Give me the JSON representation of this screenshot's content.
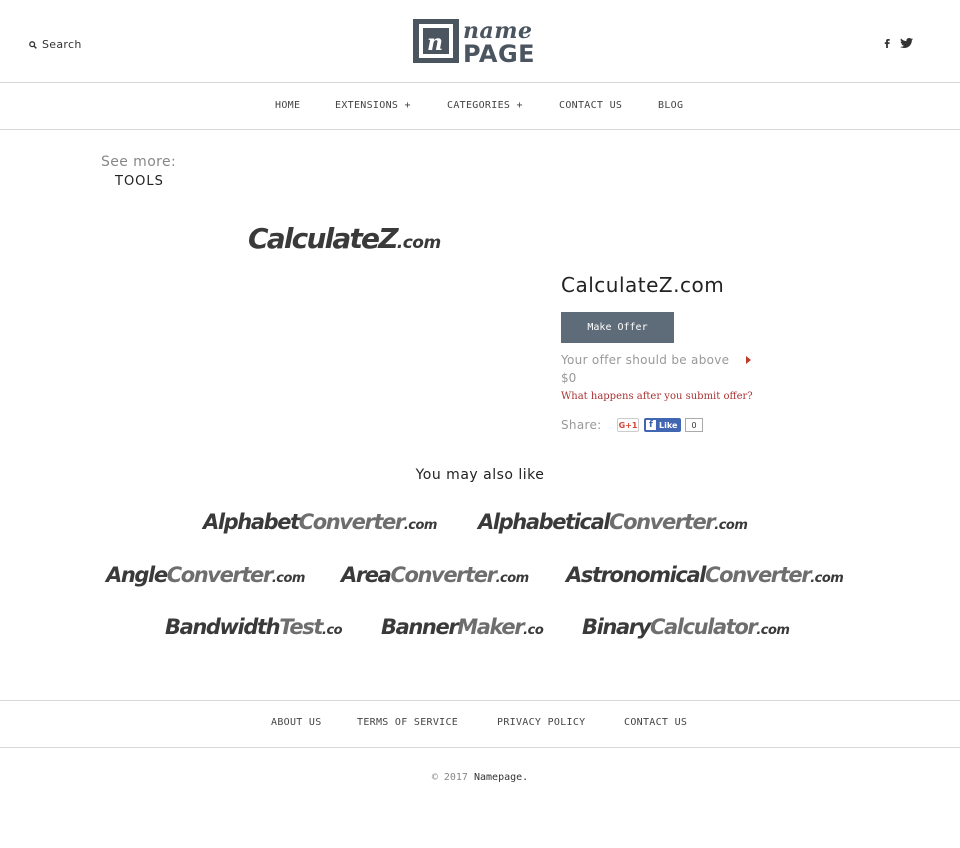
{
  "header": {
    "search_label": "Search",
    "logo": {
      "top": "name",
      "bottom": "PAGE",
      "mark": "n"
    },
    "social": [
      "facebook-icon",
      "twitter-icon"
    ]
  },
  "nav": {
    "items": [
      {
        "label": "HOME"
      },
      {
        "label": "EXTENSIONS +"
      },
      {
        "label": "CATEGORIES +"
      },
      {
        "label": "CONTACT US"
      },
      {
        "label": "BLOG"
      }
    ]
  },
  "see_more": {
    "label": "See more:",
    "category": "TOOLS"
  },
  "domain": {
    "logo_main": "CalculateZ",
    "logo_tld": ".com",
    "name": "CalculateZ.com",
    "make_offer": "Make Offer",
    "offer_note": "Your offer should be above",
    "offer_price": "$0",
    "what_happens": "What happens after you submit offer?",
    "share_label": "Share:",
    "gplus_label": "G+1",
    "fb_label": "Like",
    "fb_count": "0"
  },
  "also": {
    "title": "You may also like",
    "items": [
      {
        "a": "Alphabet",
        "b": "Converter",
        "tld": ".com"
      },
      {
        "a": "Alphabetical",
        "b": "Converter",
        "tld": ".com"
      },
      {
        "a": "Angle",
        "b": "Converter",
        "tld": ".com"
      },
      {
        "a": "Area",
        "b": "Converter",
        "tld": ".com"
      },
      {
        "a": "Astronomical",
        "b": "Converter",
        "tld": ".com"
      },
      {
        "a": "Bandwidth",
        "b": "Test",
        "tld": ".co"
      },
      {
        "a": "Banner",
        "b": "Maker",
        "tld": ".co"
      },
      {
        "a": "Binary",
        "b": "Calculator",
        "tld": ".com"
      }
    ]
  },
  "footer": {
    "links": [
      {
        "label": "ABOUT US"
      },
      {
        "label": "TERMS OF SERVICE"
      },
      {
        "label": "PRIVACY POLICY"
      },
      {
        "label": "CONTACT US"
      }
    ],
    "copyright": "© 2017",
    "brand": "Namepage."
  },
  "colors": {
    "button_bg": "#5e6b78",
    "link_red": "#a33",
    "logo_dark": "#3a3a3a",
    "logo_light": "#6e6e6e",
    "logo_brand": "#4a5560"
  }
}
